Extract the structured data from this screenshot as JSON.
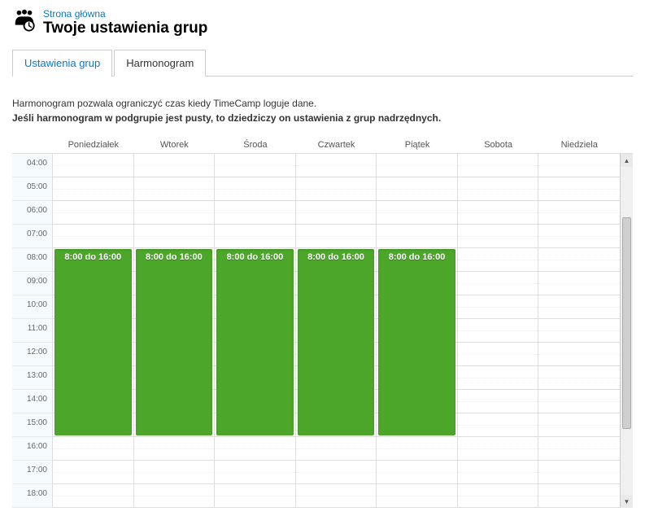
{
  "breadcrumb": {
    "home": "Strona główna"
  },
  "page_title": "Twoje ustawienia grup",
  "tabs": [
    {
      "label": "Ustawienia grup",
      "active": false
    },
    {
      "label": "Harmonogram",
      "active": true
    }
  ],
  "description": {
    "line1": "Harmonogram pozwala ograniczyć czas kiedy TimeCamp loguje dane.",
    "line2": "Jeśli harmonogram w podgrupie jest pusty, to dziedziczy on ustawienia z grup nadrzędnych."
  },
  "days": [
    "Poniedziałek",
    "Wtorek",
    "Środa",
    "Czwartek",
    "Piątek",
    "Sobota",
    "Niedziela"
  ],
  "visible_hours": [
    "04:00",
    "05:00",
    "06:00",
    "07:00",
    "08:00",
    "09:00",
    "10:00",
    "11:00",
    "12:00",
    "13:00",
    "14:00",
    "15:00",
    "16:00",
    "17:00",
    "18:00"
  ],
  "events": [
    {
      "day": 0,
      "start": "08:00",
      "end": "16:00",
      "label": "8:00 do 16:00"
    },
    {
      "day": 1,
      "start": "08:00",
      "end": "16:00",
      "label": "8:00 do 16:00"
    },
    {
      "day": 2,
      "start": "08:00",
      "end": "16:00",
      "label": "8:00 do 16:00"
    },
    {
      "day": 3,
      "start": "08:00",
      "end": "16:00",
      "label": "8:00 do 16:00"
    },
    {
      "day": 4,
      "start": "08:00",
      "end": "16:00",
      "label": "8:00 do 16:00"
    }
  ]
}
